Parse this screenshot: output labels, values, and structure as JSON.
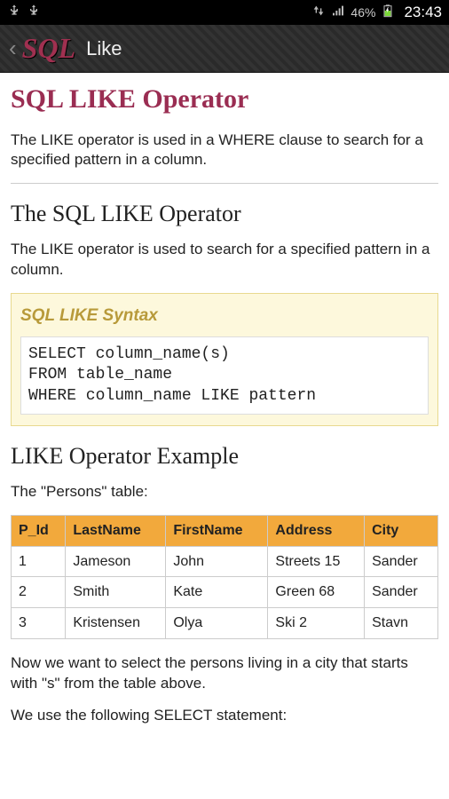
{
  "status": {
    "battery_pct": "46%",
    "time": "23:43"
  },
  "appbar": {
    "logo": "SQL",
    "title": "Like"
  },
  "page": {
    "h1": "SQL LIKE Operator",
    "intro": "The LIKE operator is used in a WHERE clause to search for a specified pattern in a column.",
    "h2_operator": "The SQL LIKE Operator",
    "operator_desc": "The LIKE operator is used to search for a specified pattern in a column.",
    "syntax_title": "SQL LIKE Syntax",
    "syntax_code": "SELECT column_name(s)\nFROM table_name\nWHERE column_name LIKE pattern",
    "h2_example": "LIKE Operator Example",
    "example_intro": "The \"Persons\" table:",
    "table": {
      "headers": [
        "P_Id",
        "LastName",
        "FirstName",
        "Address",
        "City"
      ],
      "rows": [
        [
          "1",
          "Jameson",
          "John",
          "Streets 15",
          "Sander"
        ],
        [
          "2",
          "Smith",
          "Kate",
          "Green 68",
          "Sander"
        ],
        [
          "3",
          "Kristensen",
          "Olya",
          "Ski 2",
          "Stavn"
        ]
      ]
    },
    "example_p1": "Now we want to select the persons living in a city that starts with \"s\" from the table above.",
    "example_p2": "We use the following SELECT statement:"
  }
}
